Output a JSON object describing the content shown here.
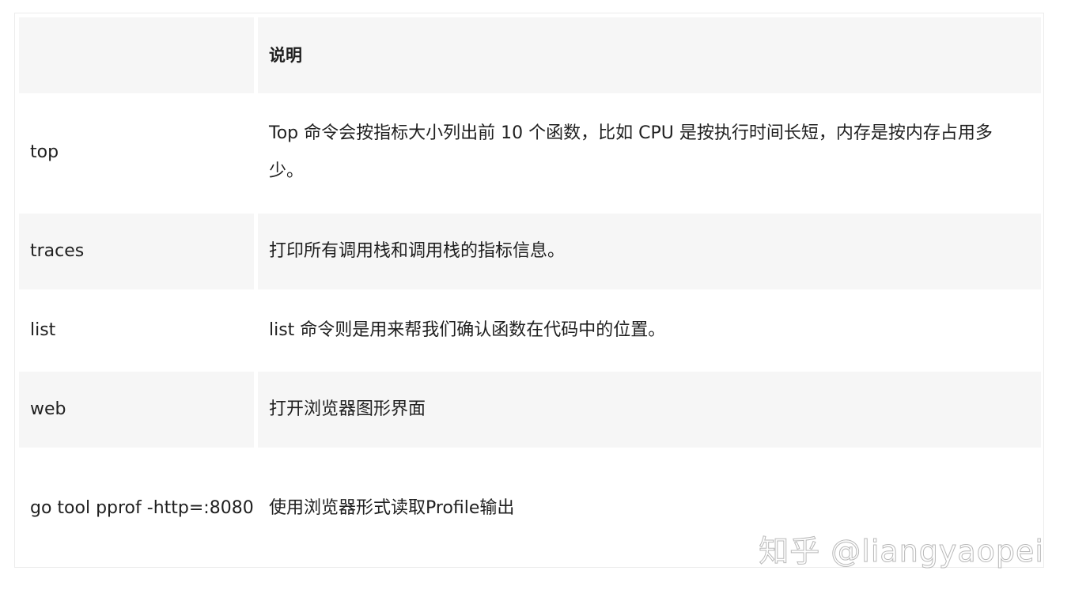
{
  "table": {
    "header": {
      "col1": "",
      "col2": "说明"
    },
    "rows": [
      {
        "command": "top",
        "description": "Top 命令会按指标大小列出前 10 个函数，比如 CPU 是按执行时间长短，内存是按内存占用多少。"
      },
      {
        "command": "traces",
        "description": "打印所有调用栈和调用栈的指标信息。"
      },
      {
        "command": "list",
        "description": "list 命令则是用来帮我们确认函数在代码中的位置。"
      },
      {
        "command": "web",
        "description": "打开浏览器图形界面"
      },
      {
        "command": "go tool pprof -http=:8080",
        "description": "使用浏览器形式读取Profile输出"
      }
    ]
  },
  "watermark": "知乎 @liangyaopei"
}
